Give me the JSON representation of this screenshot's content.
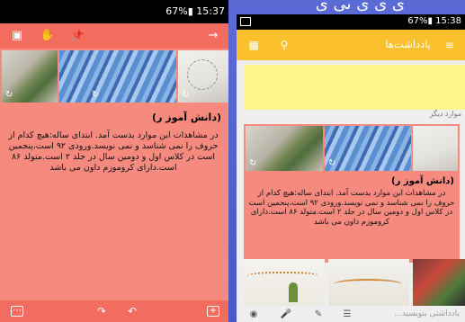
{
  "left": {
    "status": {
      "text": "67%▮ 15:37"
    },
    "note": {
      "title": "(دانش آموز ر)",
      "body": "در مشاهدات این موارد بدست آمد. ابتدای ساله:هیچ کدام از حروف را نمی شناسد و نمی نویسد.ورودی ۹۲ است،پنجمین است در کلاس اول و دومین سال در جلد ۲ است.متولد ۸۶ است.دارای کروموزم داون می باشد"
    },
    "colors": {
      "note": "#f68a7f",
      "toolbar": "#f26c60"
    }
  },
  "right": {
    "status": {
      "text": "67%▮ 15:38"
    },
    "toolbar": {
      "title": "یادداشت‌ها"
    },
    "section_label": "موارد دیگر",
    "note": {
      "title": "(دانش آموز ر)",
      "body": "در مشاهدات این موارد بدست آمد. ابتدای ساله:هیچ کدام از حروف را نمی شناسد و نمی نویسد.ورودی ۹۲ است،پنجمین است در کلاس اول و دومین سال در جلد ۲ است.متولد ۸۶ است.دارای کروموزم داون می باشد"
    },
    "bottom_hint": "یادداشتی بنویسید...",
    "colors": {
      "toolbar": "#fbc02d",
      "yellow_note": "#fff48a"
    }
  },
  "icons": [
    "archive-icon",
    "hand-icon",
    "pin-icon",
    "forward-arrow-icon",
    "grid-view-icon",
    "search-icon",
    "menu-icon",
    "undo-icon",
    "redo-icon",
    "add-icon",
    "camera-icon",
    "mic-icon",
    "draw-icon",
    "list-icon",
    "sync-icon"
  ]
}
